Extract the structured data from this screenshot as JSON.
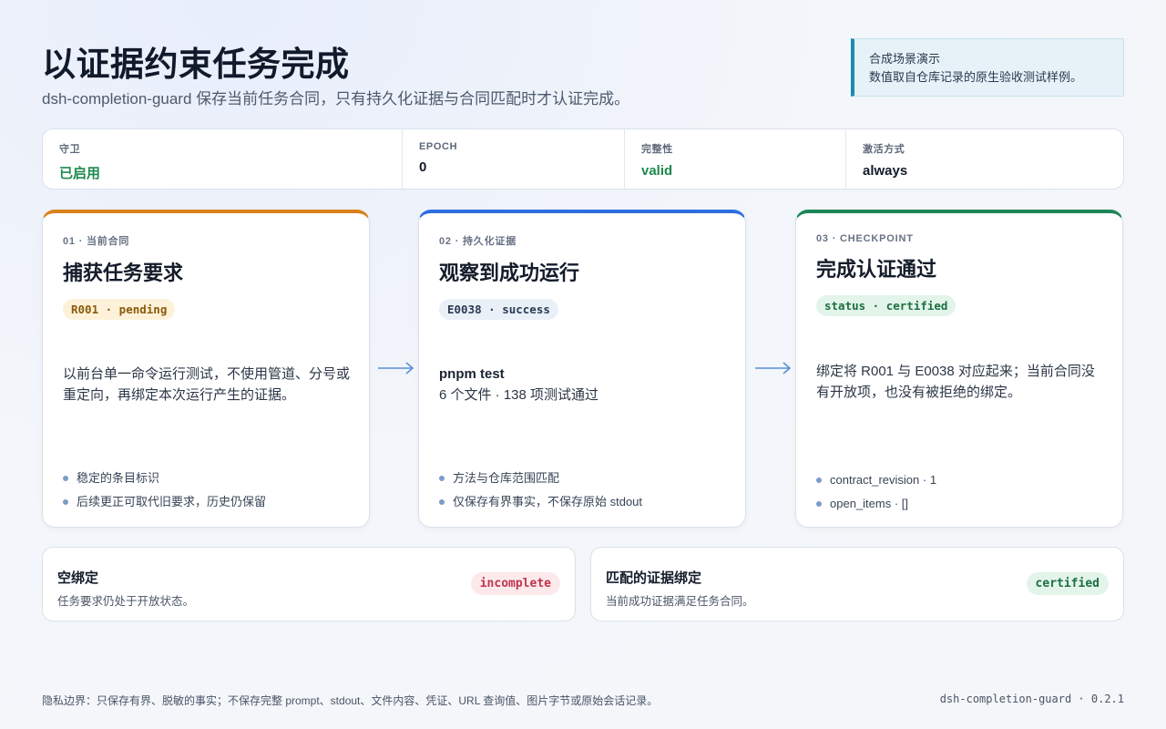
{
  "header": {
    "title": "以证据约束任务完成",
    "subtitle": "dsh-completion-guard 保存当前任务合同，只有持久化证据与合同匹配时才认证完成。"
  },
  "notice": {
    "line1": "合成场景演示",
    "line2": "数值取自仓库记录的原生验收测试样例。"
  },
  "status": [
    {
      "key": "守卫",
      "value": "已启用",
      "accent": "green"
    },
    {
      "key": "EPOCH",
      "value": "0",
      "accent": "dark"
    },
    {
      "key": "完整性",
      "value": "valid",
      "accent": "green"
    },
    {
      "key": "激活方式",
      "value": "always",
      "accent": "dark"
    }
  ],
  "cards": [
    {
      "kicker": "01 · 当前合同",
      "title": "捕获任务要求",
      "badge": "R001 · pending",
      "body_strong": "",
      "body": "以前台单一命令运行测试，不使用管道、分号或重定向，再绑定本次运行产生的证据。",
      "items": [
        "稳定的条目标识",
        "后续更正可取代旧要求，历史仍保留"
      ]
    },
    {
      "kicker": "02 · 持久化证据",
      "title": "观察到成功运行",
      "badge": "E0038 · success",
      "body_strong": "pnpm test",
      "body": "6 个文件 · 138 项测试通过",
      "items": [
        "方法与仓库范围匹配",
        "仅保存有界事实，不保存原始 stdout"
      ]
    },
    {
      "kicker": "03 · CHECKPOINT",
      "title": "完成认证通过",
      "badge": "status · certified",
      "body_strong": "",
      "body": "绑定将 R001 与 E0038 对应起来；当前合同没有开放项，也没有被拒绝的绑定。",
      "items": [
        "contract_revision · 1",
        "open_items · []"
      ]
    }
  ],
  "outcomes": [
    {
      "title": "空绑定",
      "desc": "任务要求仍处于开放状态。",
      "pill": "incomplete"
    },
    {
      "title": "匹配的证据绑定",
      "desc": "当前成功证据满足任务合同。",
      "pill": "certified"
    }
  ],
  "footer": {
    "privacy": "隐私边界：只保存有界、脱敏的事实；不保存完整 prompt、stdout、文件内容、凭证、URL 查询值、图片字节或原始会话记录。",
    "version": "dsh-completion-guard · 0.2.1"
  },
  "colors": {
    "amber": "#d9811a",
    "blue": "#2f6ee0",
    "green": "#1e8657",
    "arrow": "#5b8fd8"
  }
}
